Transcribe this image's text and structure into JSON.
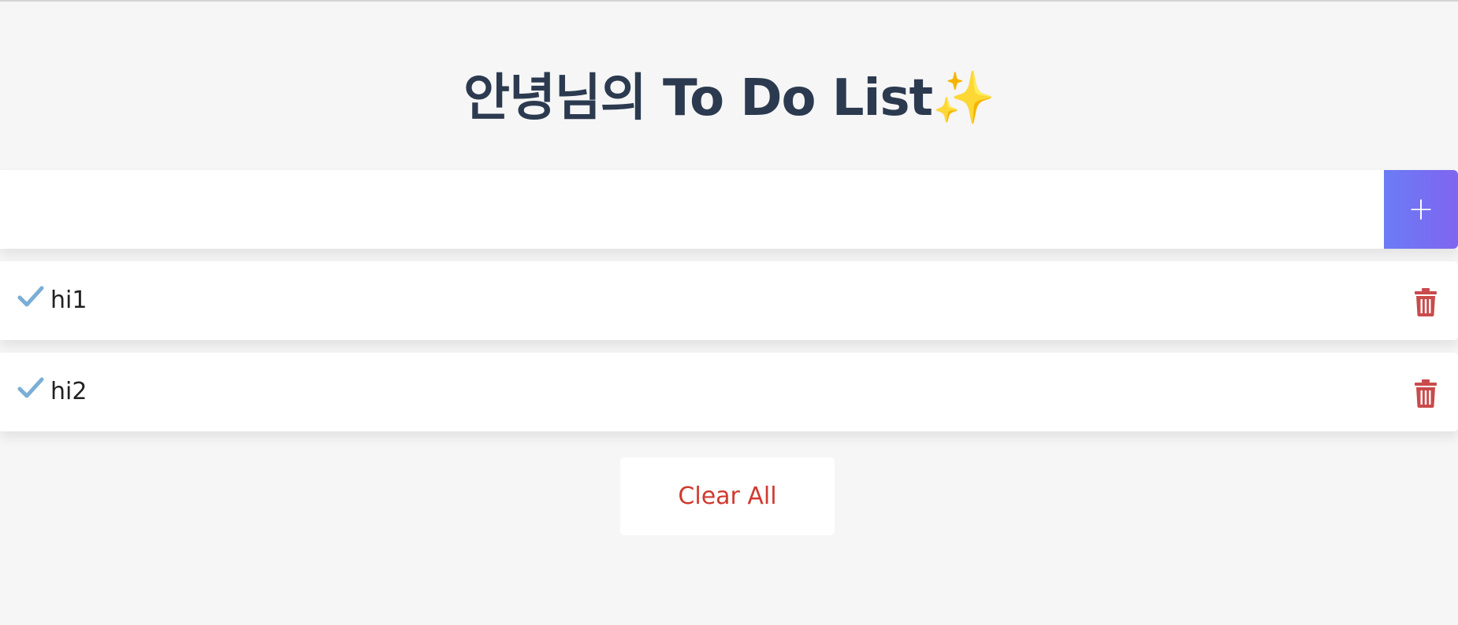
{
  "header": {
    "title_text": "안녕님의 To Do List",
    "title_emoji": "✨"
  },
  "input": {
    "value": "",
    "placeholder": ""
  },
  "add_button": {
    "label": "+"
  },
  "todos": [
    {
      "text": "hi1",
      "check_icon": "check-icon",
      "delete_icon": "trash-icon"
    },
    {
      "text": "hi2",
      "check_icon": "check-icon",
      "delete_icon": "trash-icon"
    }
  ],
  "footer": {
    "clear_label": "Clear All"
  },
  "colors": {
    "background": "#f6f6f6",
    "title": "#2c3a50",
    "accent_start": "#6b7cf5",
    "accent_end": "#7f65f0",
    "check": "#7aaed6",
    "delete": "#c94b4b",
    "clear_text": "#d03a2f"
  }
}
